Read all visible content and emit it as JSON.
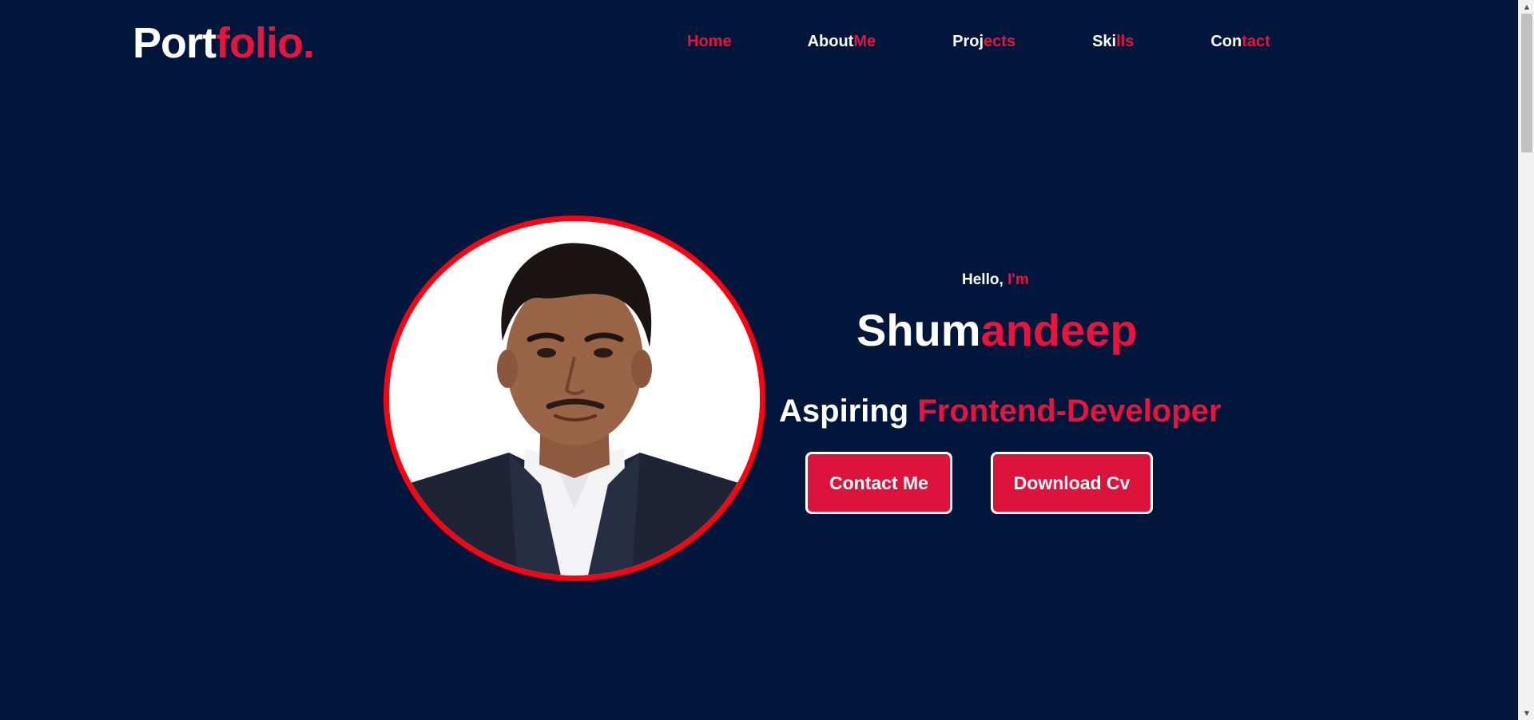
{
  "colors": {
    "background": "#00163b",
    "accent": "#e8143c",
    "text": "#ffffff",
    "avatar_ring": "#ff0011"
  },
  "header": {
    "logo": {
      "part1": "Port",
      "part2": "folio."
    },
    "nav": [
      {
        "label": "Home",
        "active": true
      },
      {
        "label_white": "About",
        "label_red": "Me"
      },
      {
        "label_white": "Proj",
        "label_red": "ects"
      },
      {
        "label_white": "Ski",
        "label_red": "lls"
      },
      {
        "label_white": "Con",
        "label_red": "tact"
      }
    ]
  },
  "hero": {
    "greeting": {
      "white": "Hello,",
      "red": "I'm"
    },
    "name": {
      "white": "Shum",
      "red": "andeep"
    },
    "tagline": {
      "white": "Aspiring",
      "red": "Frontend-Developer"
    },
    "buttons": {
      "contact": "Contact Me",
      "download": "Download Cv"
    }
  },
  "scrollbar": {
    "up_icon": "triangle-up",
    "down_icon": "triangle-down"
  }
}
